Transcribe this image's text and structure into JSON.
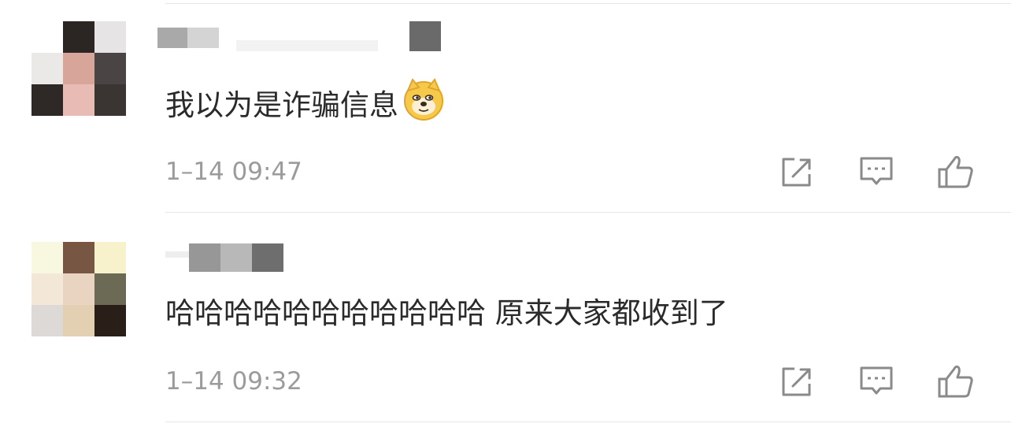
{
  "comments": [
    {
      "text": "我以为是诈骗信息",
      "emoji": "doge-emoji",
      "time": "1–14 09:47",
      "actions": [
        "share-icon",
        "comment-icon",
        "like-icon"
      ]
    },
    {
      "text": "哈哈哈哈哈哈哈哈哈哈哈 原来大家都收到了",
      "time": "1–14 09:32",
      "actions": [
        "share-icon",
        "comment-icon",
        "like-icon"
      ]
    }
  ],
  "colors": {
    "text": "#2a2a2a",
    "meta": "#9b9b9b",
    "icon": "#8a8a8a",
    "divider": "#e6e6e6"
  }
}
